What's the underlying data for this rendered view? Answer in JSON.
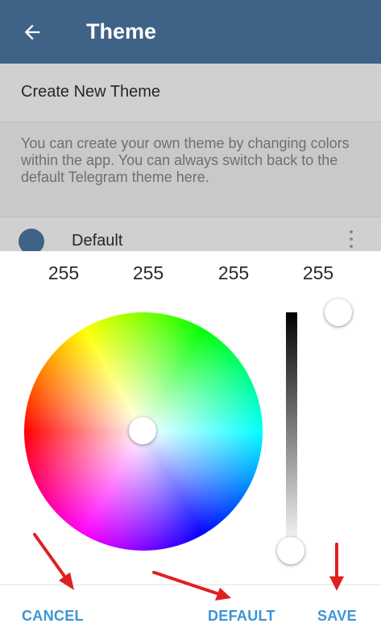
{
  "app_bar": {
    "title": "Theme",
    "back_icon": "arrow-left-icon",
    "background": "#3f6287"
  },
  "settings": {
    "create_label": "Create New Theme",
    "hint": "You can create your own theme by changing colors within the app. You can always switch back to the default Telegram theme here.",
    "themes": [
      {
        "name": "Default",
        "color": "#3f6287",
        "menu_icon": "more-vertical-icon"
      }
    ]
  },
  "color_picker": {
    "values": [
      "255",
      "255",
      "255",
      "255"
    ],
    "wheel_icon": "color-wheel",
    "brightness_slider_level": 1.0,
    "alpha_slider_level": 1.0
  },
  "dialog_actions": {
    "cancel": "CANCEL",
    "default": "DEFAULT",
    "save": "SAVE"
  },
  "accent_color": "#3a95d5",
  "annotation_color": "#e02020"
}
